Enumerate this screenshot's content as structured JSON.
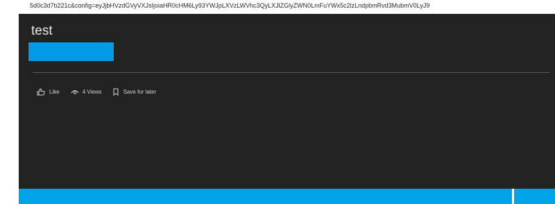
{
  "url_fragment": "5d0c3d7b221c&config=eyJjbHVzdGVyVXJsIjoiaHR0cHM6Ly93YWJpLXVzLWVhc3QyLXJlZGlyZWN0LmFuYWx5c2lzLndpbmRvd3MubmV0LyJ9",
  "card": {
    "title": "test",
    "block_color": "#039be5",
    "actions": {
      "like_label": "Like",
      "views_label": "4 Views",
      "save_label": "Save for later"
    }
  },
  "colors": {
    "panel_bg": "#222222",
    "accent": "#00a2e8"
  },
  "icons": {
    "like": "thumbs-up-icon",
    "views": "eye-icon",
    "save": "bookmark-icon"
  }
}
